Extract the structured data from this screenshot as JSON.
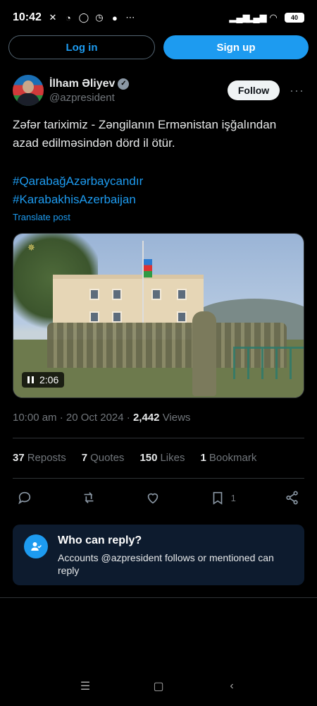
{
  "status_bar": {
    "time": "10:42",
    "battery": "40"
  },
  "auth": {
    "login_label": "Log in",
    "signup_label": "Sign up"
  },
  "author": {
    "name": "İlham Əliyev",
    "handle": "@azpresident",
    "follow_label": "Follow"
  },
  "post": {
    "text": "Zəfər tariximiz - Zəngilanın Ermənistan işğalından azad edilməsindən dörd il ötür.",
    "hashtags": [
      "#QarabağAzərbaycandır",
      "#KarabakhisAzerbaijan"
    ],
    "translate_label": "Translate post",
    "video_duration": "2:06"
  },
  "meta": {
    "time": "10:00 am",
    "date": "20 Oct 2024",
    "views_count": "2,442",
    "views_label": "Views"
  },
  "stats": {
    "reposts_count": "37",
    "reposts_label": "Reposts",
    "quotes_count": "7",
    "quotes_label": "Quotes",
    "likes_count": "150",
    "likes_label": "Likes",
    "bookmarks_count": "1",
    "bookmarks_label": "Bookmark"
  },
  "actions": {
    "bookmark_count": "1"
  },
  "reply": {
    "title": "Who can reply?",
    "description": "Accounts @azpresident follows or mentioned can reply"
  },
  "colors": {
    "accent": "#1d9bf0",
    "background": "#000000",
    "muted": "#71767b"
  }
}
